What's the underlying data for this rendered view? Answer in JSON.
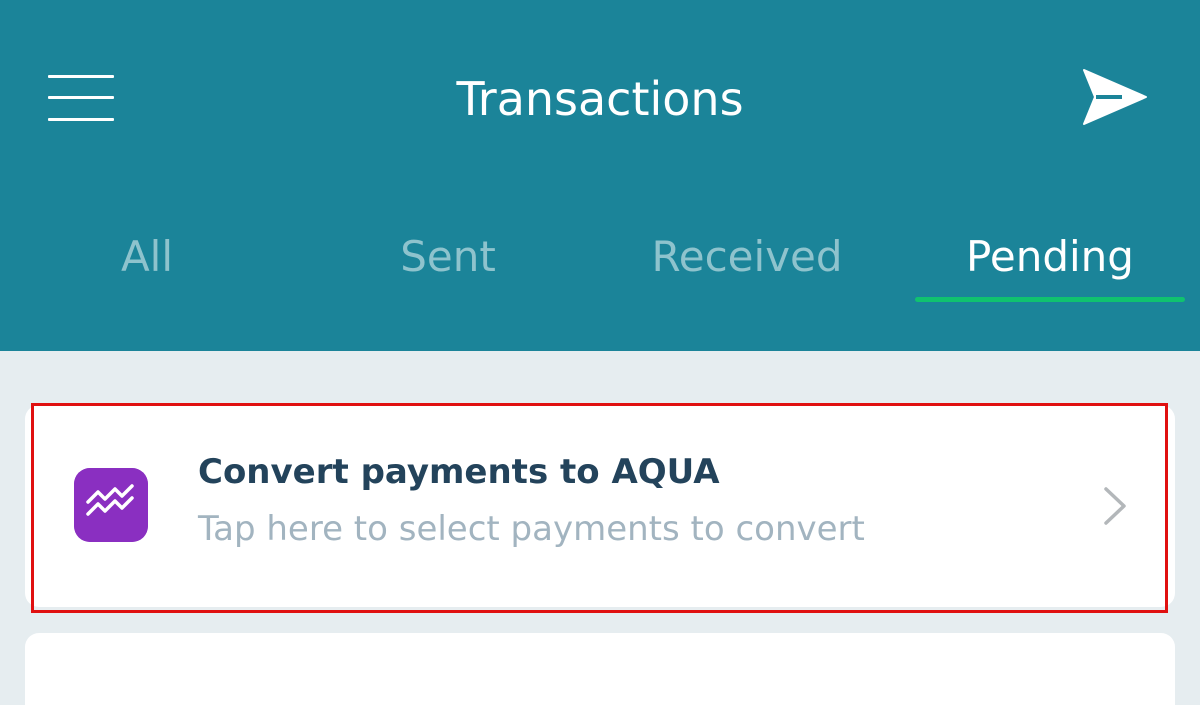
{
  "header": {
    "title": "Transactions",
    "menu_icon": "hamburger-menu-icon",
    "send_icon": "paper-plane-send-icon"
  },
  "tabs": [
    {
      "label": "All",
      "active": false
    },
    {
      "label": "Sent",
      "active": false
    },
    {
      "label": "Received",
      "active": false
    },
    {
      "label": "Pending",
      "active": true
    }
  ],
  "convert_card": {
    "icon": "aqua-logo-icon",
    "title": "Convert payments to AQUA",
    "subtitle": "Tap here to select payments to convert",
    "chevron_icon": "chevron-right-icon"
  },
  "colors": {
    "header_bg": "#1b8499",
    "active_tab_underline": "#10c26f",
    "highlight_border": "#e01010",
    "aqua_icon_bg": "#8a2fc1",
    "card_title": "#23435b",
    "card_subtitle": "#a2b4c0",
    "page_bg": "#e6edf0"
  }
}
